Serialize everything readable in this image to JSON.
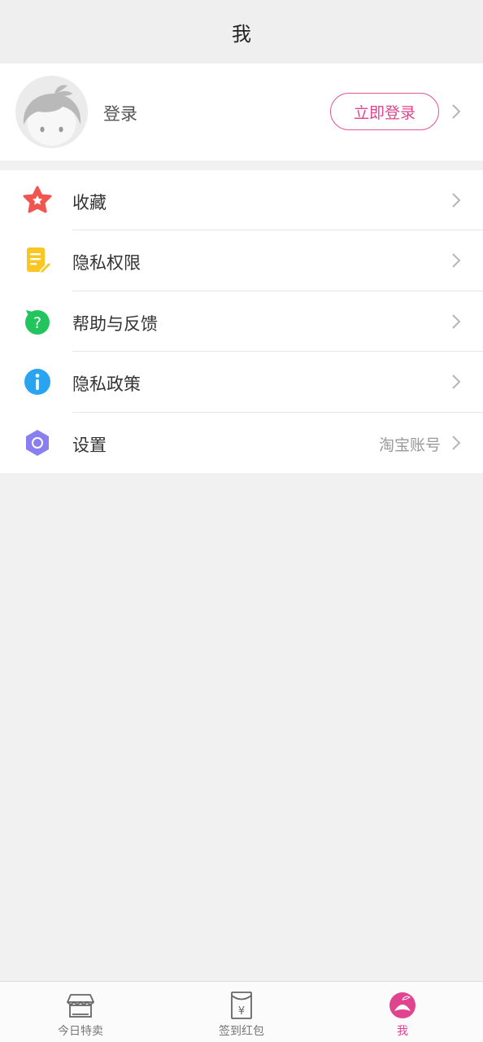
{
  "header": {
    "title": "我"
  },
  "profile": {
    "login_text": "登录",
    "login_button": "立即登录"
  },
  "menu": {
    "items": [
      {
        "label": "收藏",
        "icon": "star-icon",
        "value": ""
      },
      {
        "label": "隐私权限",
        "icon": "notepad-pencil-icon",
        "value": ""
      },
      {
        "label": "帮助与反馈",
        "icon": "question-bubble-icon",
        "value": ""
      },
      {
        "label": "隐私政策",
        "icon": "info-icon",
        "value": ""
      },
      {
        "label": "设置",
        "icon": "hexagon-settings-icon",
        "value": "淘宝账号"
      }
    ]
  },
  "tabbar": {
    "tabs": [
      {
        "label": "今日特卖",
        "icon": "shop-icon",
        "active": false
      },
      {
        "label": "签到红包",
        "icon": "red-envelope-icon",
        "active": false
      },
      {
        "label": "我",
        "icon": "profile-face-icon",
        "active": true
      }
    ]
  },
  "colors": {
    "accent": "#e0448e",
    "background": "#f1f1f1",
    "star": "#f0554f",
    "notepad": "#f9c623",
    "help": "#22c45e",
    "info": "#2aa3f0",
    "settings": "#8a7ff0"
  }
}
